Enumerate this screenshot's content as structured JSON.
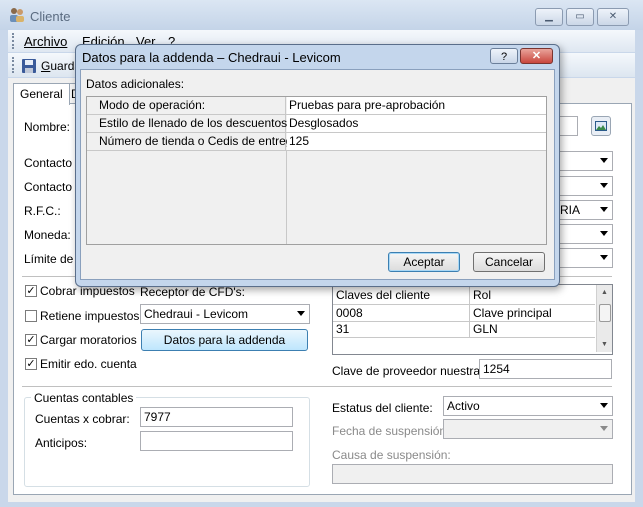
{
  "window": {
    "title": "Cliente"
  },
  "menu": {
    "archivo": "Archivo",
    "edicion": "Edición",
    "ver": "Ver",
    "help": "?"
  },
  "toolbar": {
    "guardar": "Guardar"
  },
  "tabs": [
    "General",
    "D"
  ],
  "form": {
    "nombre": "Nombre:",
    "contacto1": "Contacto 1",
    "contacto2": "Contacto 2",
    "rfc": "R.F.C.:",
    "moneda": "Moneda:",
    "limite": "Límite de cr",
    "rfc_combo_value": "RIA"
  },
  "checks": {
    "cobrar_impuestos": {
      "label": "Cobrar impuestos",
      "checked": true
    },
    "retiene_impuestos": {
      "label": "Retiene impuestos",
      "checked": false
    },
    "cargar_moratorios": {
      "label": "Cargar moratorios",
      "checked": true
    },
    "emitir_edo": {
      "label": "Emitir edo. cuenta",
      "checked": true
    }
  },
  "receptor": {
    "label": "Receptor de CFD's:",
    "value": "Chedraui - Levicom",
    "addenda_button": "Datos para la addenda"
  },
  "claves_grid": {
    "headers": [
      "Claves del cliente",
      "Rol"
    ],
    "rows": [
      [
        "0008",
        "Clave principal"
      ],
      [
        "31",
        "GLN"
      ]
    ]
  },
  "proveedor": {
    "label": "Clave de proveedor nuestra:",
    "value": "1254"
  },
  "cuentas": {
    "title": "Cuentas contables",
    "cobrar_label": "Cuentas x cobrar:",
    "cobrar_value": "7977",
    "anticipos_label": "Anticipos:",
    "anticipos_value": ""
  },
  "estatus": {
    "label": "Estatus del cliente:",
    "value": "Activo",
    "fecha_label": "Fecha de suspensión:",
    "causa_label": "Causa de suspensión:"
  },
  "dialog": {
    "title": "Datos para la addenda – Chedraui - Levicom",
    "section": "Datos adicionales:",
    "rows": [
      {
        "label": "Modo de operación:",
        "value": "Pruebas para pre-aprobación"
      },
      {
        "label": "Estilo de llenado de los descuentos:",
        "value": "Desglosados"
      },
      {
        "label": "Número de tienda o Cedis de entrega:",
        "value": "125"
      }
    ],
    "aceptar": "Aceptar",
    "cancelar": "Cancelar",
    "help": "?",
    "close": "✕"
  },
  "colors": {
    "accent": "#3c7fb1",
    "close_red": "#c9463d",
    "title_blue": "#c4d6ec"
  }
}
